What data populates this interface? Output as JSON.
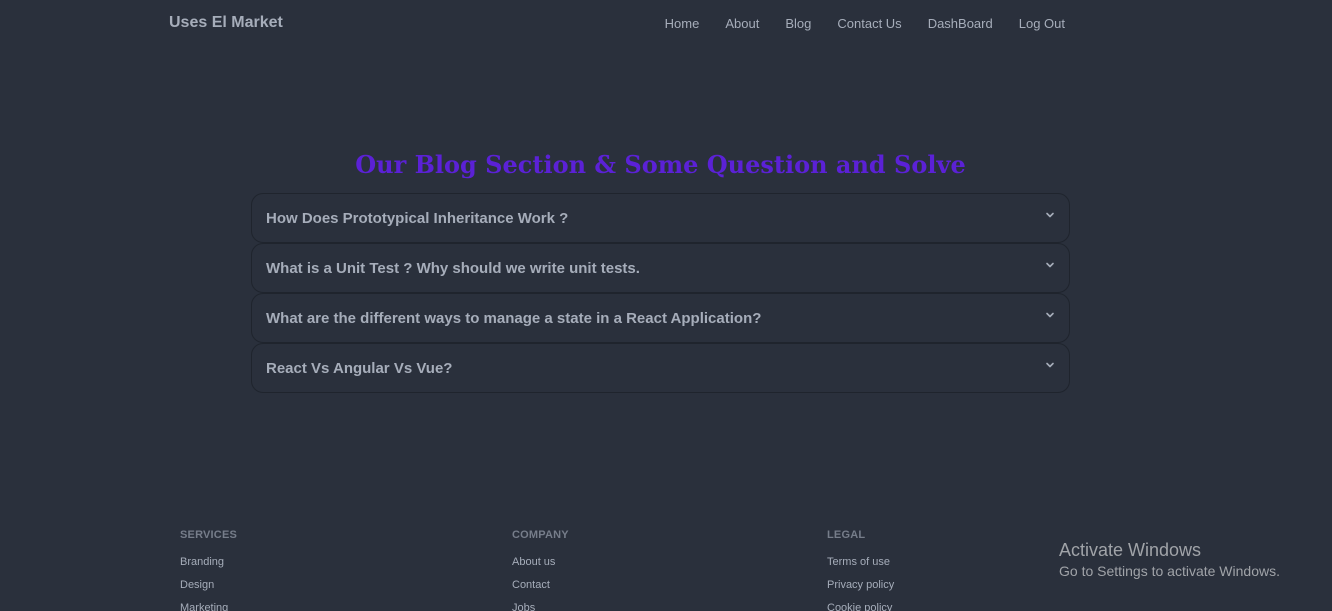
{
  "navbar": {
    "brand": "Uses El Market",
    "links": [
      "Home",
      "About",
      "Blog",
      "Contact Us",
      "DashBoard",
      "Log Out"
    ]
  },
  "blog": {
    "title": "Our Blog Section & Some Question and Solve",
    "questions": [
      "How Does Prototypical Inheritance Work ?",
      "What is a Unit Test ? Why should we write unit tests.",
      "What are the different ways to manage a state in a React Application?",
      "React Vs Angular Vs Vue?"
    ]
  },
  "footer": {
    "services": {
      "title": "SERVICES",
      "links": [
        "Branding",
        "Design",
        "Marketing"
      ]
    },
    "company": {
      "title": "COMPANY",
      "links": [
        "About us",
        "Contact",
        "Jobs"
      ]
    },
    "legal": {
      "title": "LEGAL",
      "links": [
        "Terms of use",
        "Privacy policy",
        "Cookie policy"
      ]
    }
  },
  "watermark": {
    "title": "Activate Windows",
    "subtitle": "Go to Settings to activate Windows."
  },
  "colors": {
    "background": "#2a303c",
    "title_accent": "#5b21d6",
    "text": "#a6adba"
  },
  "icons": {
    "accordion_toggle": "chevron-down-icon"
  }
}
